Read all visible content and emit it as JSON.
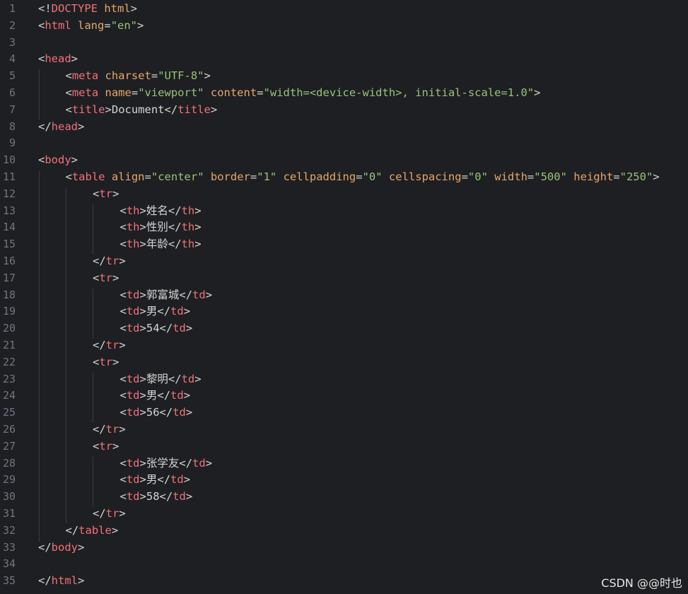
{
  "editor": {
    "lines": [
      {
        "n": "1",
        "indent": 0,
        "tokens": [
          [
            "p",
            "<!"
          ],
          [
            "t",
            "DOCTYPE"
          ],
          [
            "x",
            " "
          ],
          [
            "a",
            "html"
          ],
          [
            "p",
            ">"
          ]
        ]
      },
      {
        "n": "2",
        "indent": 0,
        "tokens": [
          [
            "p",
            "<"
          ],
          [
            "t",
            "html"
          ],
          [
            "x",
            " "
          ],
          [
            "a",
            "lang"
          ],
          [
            "p",
            "="
          ],
          [
            "s",
            "\"en\""
          ],
          [
            "p",
            ">"
          ]
        ]
      },
      {
        "n": "3",
        "indent": 0,
        "tokens": []
      },
      {
        "n": "4",
        "indent": 0,
        "tokens": [
          [
            "p",
            "<"
          ],
          [
            "t",
            "head"
          ],
          [
            "p",
            ">"
          ]
        ]
      },
      {
        "n": "5",
        "indent": 1,
        "tokens": [
          [
            "p",
            "<"
          ],
          [
            "t",
            "meta"
          ],
          [
            "x",
            " "
          ],
          [
            "a",
            "charset"
          ],
          [
            "p",
            "="
          ],
          [
            "s",
            "\"UTF-8\""
          ],
          [
            "p",
            ">"
          ]
        ]
      },
      {
        "n": "6",
        "indent": 1,
        "tokens": [
          [
            "p",
            "<"
          ],
          [
            "t",
            "meta"
          ],
          [
            "x",
            " "
          ],
          [
            "a",
            "name"
          ],
          [
            "p",
            "="
          ],
          [
            "s",
            "\"viewport\""
          ],
          [
            "x",
            " "
          ],
          [
            "a",
            "content"
          ],
          [
            "p",
            "="
          ],
          [
            "s",
            "\"width=<device-width>, initial-scale=1.0\""
          ],
          [
            "p",
            ">"
          ]
        ]
      },
      {
        "n": "7",
        "indent": 1,
        "tokens": [
          [
            "p",
            "<"
          ],
          [
            "t",
            "title"
          ],
          [
            "p",
            ">"
          ],
          [
            "x",
            "Document"
          ],
          [
            "p",
            "</"
          ],
          [
            "t",
            "title"
          ],
          [
            "p",
            ">"
          ]
        ]
      },
      {
        "n": "8",
        "indent": 0,
        "tokens": [
          [
            "p",
            "</"
          ],
          [
            "t",
            "head"
          ],
          [
            "p",
            ">"
          ]
        ]
      },
      {
        "n": "9",
        "indent": 0,
        "tokens": []
      },
      {
        "n": "10",
        "indent": 0,
        "tokens": [
          [
            "p",
            "<"
          ],
          [
            "t",
            "body"
          ],
          [
            "p",
            ">"
          ]
        ]
      },
      {
        "n": "11",
        "indent": 1,
        "tokens": [
          [
            "p",
            "<"
          ],
          [
            "t",
            "table"
          ],
          [
            "x",
            " "
          ],
          [
            "a",
            "align"
          ],
          [
            "p",
            "="
          ],
          [
            "s",
            "\"center\""
          ],
          [
            "x",
            " "
          ],
          [
            "a",
            "border"
          ],
          [
            "p",
            "="
          ],
          [
            "s",
            "\"1\""
          ],
          [
            "x",
            " "
          ],
          [
            "a",
            "cellpadding"
          ],
          [
            "p",
            "="
          ],
          [
            "s",
            "\"0\""
          ],
          [
            "x",
            " "
          ],
          [
            "a",
            "cellspacing"
          ],
          [
            "p",
            "="
          ],
          [
            "s",
            "\"0\""
          ],
          [
            "x",
            " "
          ],
          [
            "a",
            "width"
          ],
          [
            "p",
            "="
          ],
          [
            "s",
            "\"500\""
          ],
          [
            "x",
            " "
          ],
          [
            "a",
            "height"
          ],
          [
            "p",
            "="
          ],
          [
            "s",
            "\"250\""
          ],
          [
            "p",
            ">"
          ]
        ]
      },
      {
        "n": "12",
        "indent": 2,
        "tokens": [
          [
            "p",
            "<"
          ],
          [
            "t",
            "tr"
          ],
          [
            "p",
            ">"
          ]
        ]
      },
      {
        "n": "13",
        "indent": 3,
        "tokens": [
          [
            "p",
            "<"
          ],
          [
            "t",
            "th"
          ],
          [
            "p",
            ">"
          ],
          [
            "x",
            "姓名"
          ],
          [
            "p",
            "</"
          ],
          [
            "t",
            "th"
          ],
          [
            "p",
            ">"
          ]
        ]
      },
      {
        "n": "14",
        "indent": 3,
        "tokens": [
          [
            "p",
            "<"
          ],
          [
            "t",
            "th"
          ],
          [
            "p",
            ">"
          ],
          [
            "x",
            "性别"
          ],
          [
            "p",
            "</"
          ],
          [
            "t",
            "th"
          ],
          [
            "p",
            ">"
          ]
        ]
      },
      {
        "n": "15",
        "indent": 3,
        "tokens": [
          [
            "p",
            "<"
          ],
          [
            "t",
            "th"
          ],
          [
            "p",
            ">"
          ],
          [
            "x",
            "年龄"
          ],
          [
            "p",
            "</"
          ],
          [
            "t",
            "th"
          ],
          [
            "p",
            ">"
          ]
        ]
      },
      {
        "n": "16",
        "indent": 2,
        "tokens": [
          [
            "p",
            "</"
          ],
          [
            "t",
            "tr"
          ],
          [
            "p",
            ">"
          ]
        ]
      },
      {
        "n": "17",
        "indent": 2,
        "tokens": [
          [
            "p",
            "<"
          ],
          [
            "t",
            "tr"
          ],
          [
            "p",
            ">"
          ]
        ]
      },
      {
        "n": "18",
        "indent": 3,
        "tokens": [
          [
            "p",
            "<"
          ],
          [
            "t",
            "td"
          ],
          [
            "p",
            ">"
          ],
          [
            "x",
            "郭富城"
          ],
          [
            "p",
            "</"
          ],
          [
            "t",
            "td"
          ],
          [
            "p",
            ">"
          ]
        ]
      },
      {
        "n": "19",
        "indent": 3,
        "tokens": [
          [
            "p",
            "<"
          ],
          [
            "t",
            "td"
          ],
          [
            "p",
            ">"
          ],
          [
            "x",
            "男"
          ],
          [
            "p",
            "</"
          ],
          [
            "t",
            "td"
          ],
          [
            "p",
            ">"
          ]
        ]
      },
      {
        "n": "20",
        "indent": 3,
        "tokens": [
          [
            "p",
            "<"
          ],
          [
            "t",
            "td"
          ],
          [
            "p",
            ">"
          ],
          [
            "x",
            "54"
          ],
          [
            "p",
            "</"
          ],
          [
            "t",
            "td"
          ],
          [
            "p",
            ">"
          ]
        ]
      },
      {
        "n": "21",
        "indent": 2,
        "tokens": [
          [
            "p",
            "</"
          ],
          [
            "t",
            "tr"
          ],
          [
            "p",
            ">"
          ]
        ]
      },
      {
        "n": "22",
        "indent": 2,
        "tokens": [
          [
            "p",
            "<"
          ],
          [
            "t",
            "tr"
          ],
          [
            "p",
            ">"
          ]
        ]
      },
      {
        "n": "23",
        "indent": 3,
        "tokens": [
          [
            "p",
            "<"
          ],
          [
            "t",
            "td"
          ],
          [
            "p",
            ">"
          ],
          [
            "x",
            "黎明"
          ],
          [
            "p",
            "</"
          ],
          [
            "t",
            "td"
          ],
          [
            "p",
            ">"
          ]
        ]
      },
      {
        "n": "24",
        "indent": 3,
        "tokens": [
          [
            "p",
            "<"
          ],
          [
            "t",
            "td"
          ],
          [
            "p",
            ">"
          ],
          [
            "x",
            "男"
          ],
          [
            "p",
            "</"
          ],
          [
            "t",
            "td"
          ],
          [
            "p",
            ">"
          ]
        ]
      },
      {
        "n": "25",
        "indent": 3,
        "tokens": [
          [
            "p",
            "<"
          ],
          [
            "t",
            "td"
          ],
          [
            "p",
            ">"
          ],
          [
            "x",
            "56"
          ],
          [
            "p",
            "</"
          ],
          [
            "t",
            "td"
          ],
          [
            "p",
            ">"
          ]
        ]
      },
      {
        "n": "26",
        "indent": 2,
        "tokens": [
          [
            "p",
            "</"
          ],
          [
            "t",
            "tr"
          ],
          [
            "p",
            ">"
          ]
        ]
      },
      {
        "n": "27",
        "indent": 2,
        "tokens": [
          [
            "p",
            "<"
          ],
          [
            "t",
            "tr"
          ],
          [
            "p",
            ">"
          ]
        ]
      },
      {
        "n": "28",
        "indent": 3,
        "tokens": [
          [
            "p",
            "<"
          ],
          [
            "t",
            "td"
          ],
          [
            "p",
            ">"
          ],
          [
            "x",
            "张学友"
          ],
          [
            "p",
            "</"
          ],
          [
            "t",
            "td"
          ],
          [
            "p",
            ">"
          ]
        ]
      },
      {
        "n": "29",
        "indent": 3,
        "tokens": [
          [
            "p",
            "<"
          ],
          [
            "t",
            "td"
          ],
          [
            "p",
            ">"
          ],
          [
            "x",
            "男"
          ],
          [
            "p",
            "</"
          ],
          [
            "t",
            "td"
          ],
          [
            "p",
            ">"
          ]
        ]
      },
      {
        "n": "30",
        "indent": 3,
        "tokens": [
          [
            "p",
            "<"
          ],
          [
            "t",
            "td"
          ],
          [
            "p",
            ">"
          ],
          [
            "x",
            "58"
          ],
          [
            "p",
            "</"
          ],
          [
            "t",
            "td"
          ],
          [
            "p",
            ">"
          ]
        ]
      },
      {
        "n": "31",
        "indent": 2,
        "tokens": [
          [
            "p",
            "</"
          ],
          [
            "t",
            "tr"
          ],
          [
            "p",
            ">"
          ]
        ]
      },
      {
        "n": "32",
        "indent": 1,
        "tokens": [
          [
            "p",
            "</"
          ],
          [
            "t",
            "table"
          ],
          [
            "p",
            ">"
          ]
        ]
      },
      {
        "n": "33",
        "indent": 0,
        "tokens": [
          [
            "p",
            "</"
          ],
          [
            "t",
            "body"
          ],
          [
            "p",
            ">"
          ]
        ]
      },
      {
        "n": "34",
        "indent": 0,
        "tokens": []
      },
      {
        "n": "35",
        "indent": 0,
        "tokens": [
          [
            "p",
            "</"
          ],
          [
            "t",
            "html"
          ],
          [
            "p",
            ">"
          ]
        ]
      }
    ]
  },
  "watermark": {
    "text": "CSDN @@时也"
  },
  "colors": {
    "background": "#1e1f22",
    "line_number": "#6e7681",
    "tag": "#f07178",
    "attribute": "#e5a66b",
    "string": "#98c379",
    "text": "#d4d4d4"
  }
}
